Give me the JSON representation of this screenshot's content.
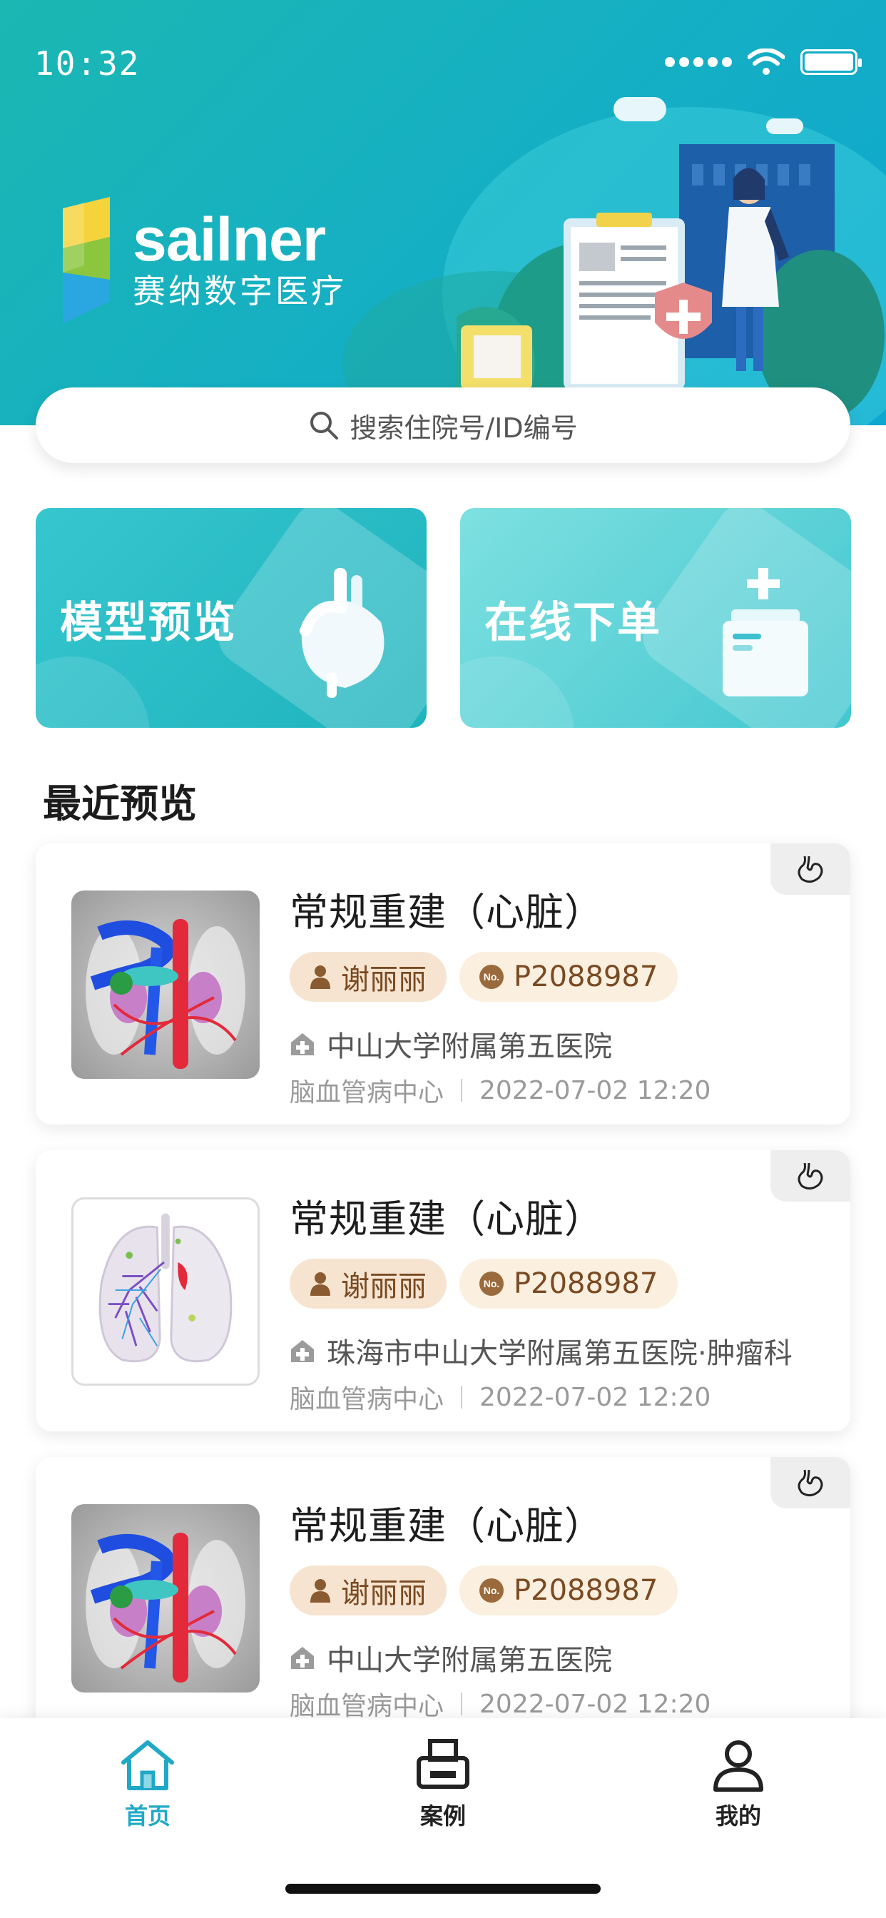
{
  "status": {
    "time": "10:32"
  },
  "brand": {
    "name_en": "sailner",
    "name_cn": "赛纳数字医疗"
  },
  "search": {
    "placeholder": "搜索住院号/ID编号"
  },
  "quick_actions": [
    {
      "label": "模型预览",
      "icon": "heart-icon"
    },
    {
      "label": "在线下单",
      "icon": "medical-kit-icon"
    }
  ],
  "section": {
    "recent_title": "最近预览"
  },
  "records": [
    {
      "title": "常规重建（心脏）",
      "patient": "谢丽丽",
      "id": "P2088987",
      "hospital": "中山大学附属第五医院",
      "department": "脑血管病中心",
      "datetime": "2022-07-02 12:20",
      "organ_icon": "stomach-icon",
      "thumb": "vessel-model"
    },
    {
      "title": "常规重建（心脏）",
      "patient": "谢丽丽",
      "id": "P2088987",
      "hospital": "珠海市中山大学附属第五医院·肿瘤科",
      "department": "脑血管病中心",
      "datetime": "2022-07-02 12:20",
      "organ_icon": "stomach-icon",
      "thumb": "lung-model"
    },
    {
      "title": "常规重建（心脏）",
      "patient": "谢丽丽",
      "id": "P2088987",
      "hospital": "中山大学附属第五医院",
      "department": "脑血管病中心",
      "datetime": "2022-07-02 12:20",
      "organ_icon": "stomach-icon",
      "thumb": "vessel-model"
    }
  ],
  "tabs": [
    {
      "label": "首页",
      "icon": "home-icon",
      "active": true
    },
    {
      "label": "案例",
      "icon": "printer-icon",
      "active": false
    },
    {
      "label": "我的",
      "icon": "user-icon",
      "active": false
    }
  ],
  "colors": {
    "accent": "#20a8c6",
    "banner": "#16b0c2",
    "chip_bg": "#f6e4d0",
    "chip_text": "#7a4a22"
  }
}
